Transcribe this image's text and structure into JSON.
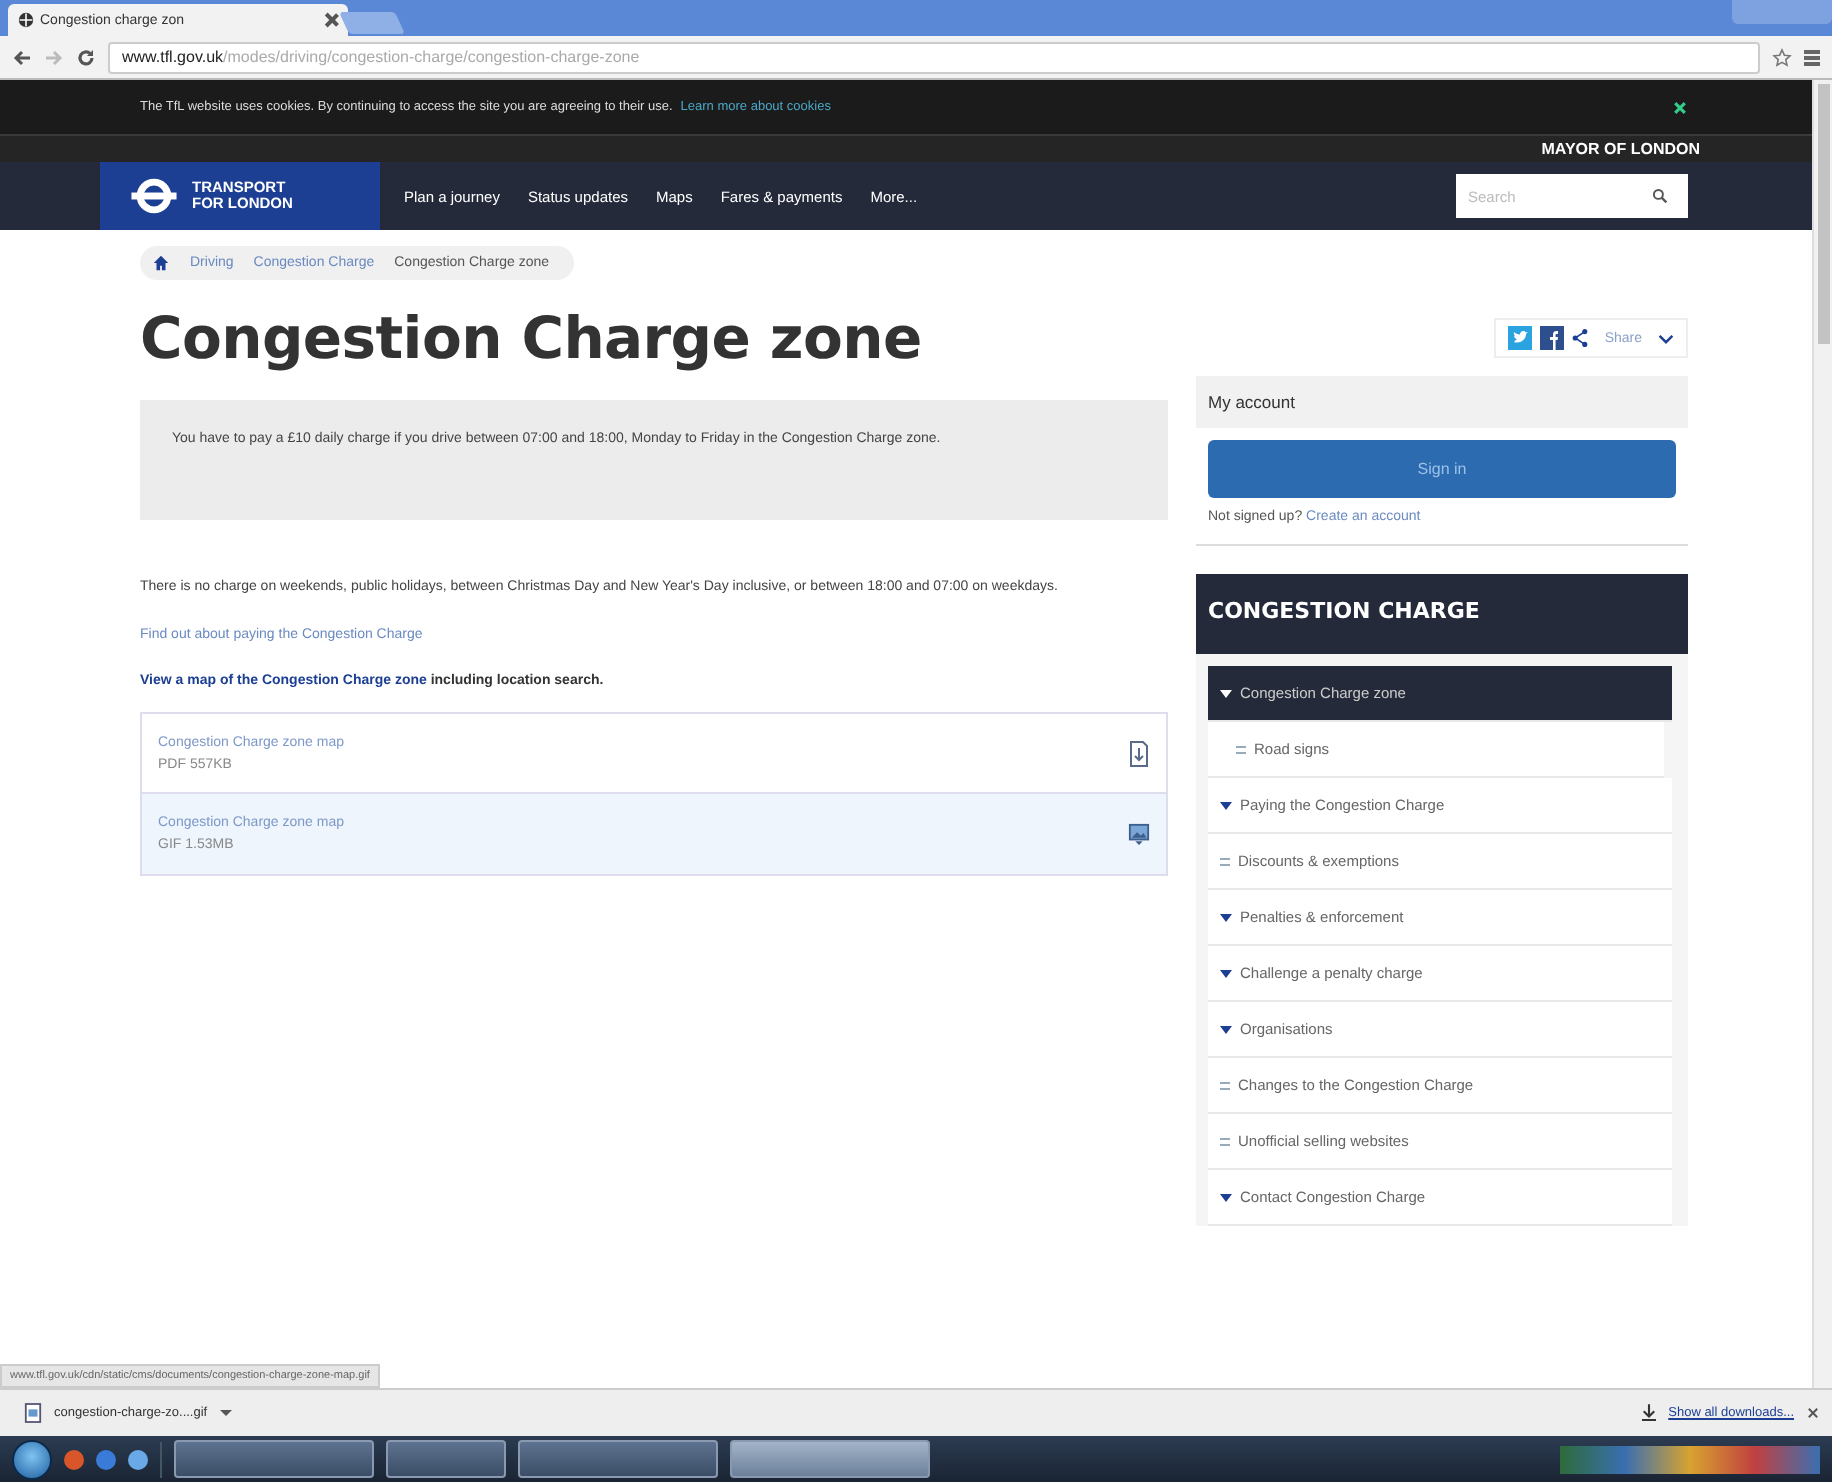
{
  "browser": {
    "tab": {
      "title": "Congestion charge zon"
    },
    "url_host": "www.tfl.gov.uk",
    "url_path": "/modes/driving/congestion-charge/congestion-charge-zone"
  },
  "cookie_bar": {
    "text": "The TfL website uses cookies. By continuing to access the site you are agreeing to their use.",
    "link": "Learn more about cookies"
  },
  "header": {
    "mayor": "MAYOR OF LONDON",
    "logo_lines": [
      "TRANSPORT",
      "FOR LONDON"
    ],
    "nav": [
      {
        "label": "Plan a journey"
      },
      {
        "label": "Status updates"
      },
      {
        "label": "Maps"
      },
      {
        "label": "Fares & payments"
      },
      {
        "label": "More..."
      }
    ],
    "search": {
      "placeholder": "Search"
    }
  },
  "breadcrumb": [
    {
      "label": "Driving"
    },
    {
      "label": "Congestion Charge"
    },
    {
      "label": "Congestion Charge zone"
    }
  ],
  "title": "Congestion Charge zone",
  "share": {
    "label": "Share"
  },
  "notice": "You have to pay a £10 daily charge if you drive between 07:00 and 18:00, Monday to Friday in the Congestion Charge zone.",
  "paragraph": "There is no charge on weekends, public holidays, between Christmas Day and New Year's Day inclusive, or between 18:00 and 07:00 on weekdays.",
  "pay_link": "Find out about paying the Congestion Charge",
  "map_link": {
    "link": "View a map of the Congestion Charge zone",
    "rest": " including location search."
  },
  "files": [
    {
      "title": "Congestion Charge zone map",
      "meta": "PDF 557KB",
      "kind": "pdf",
      "selected": false
    },
    {
      "title": "Congestion Charge zone map",
      "meta": "GIF 1.53MB",
      "kind": "image",
      "selected": true
    }
  ],
  "account": {
    "heading": "My account",
    "button": "Sign in",
    "prompt": "Not signed up?",
    "link": "Create an account"
  },
  "section": {
    "heading": "CONGESTION CHARGE",
    "items": [
      {
        "label": "Congestion Charge zone",
        "kind": "arrow",
        "selected": true,
        "children": [
          {
            "label": "Road signs",
            "kind": "dash",
            "selected": false
          }
        ]
      },
      {
        "label": "Paying the Congestion Charge",
        "kind": "arrow",
        "selected": false
      },
      {
        "label": "Discounts & exemptions",
        "kind": "dash",
        "selected": false
      },
      {
        "label": "Penalties & enforcement",
        "kind": "arrow",
        "selected": false
      },
      {
        "label": "Challenge a penalty charge",
        "kind": "arrow",
        "selected": false
      },
      {
        "label": "Organisations",
        "kind": "arrow",
        "selected": false
      },
      {
        "label": "Changes to the Congestion Charge",
        "kind": "dash",
        "selected": false
      },
      {
        "label": "Unofficial selling websites",
        "kind": "dash",
        "selected": false
      },
      {
        "label": "Contact Congestion Charge",
        "kind": "arrow",
        "selected": false
      }
    ]
  },
  "status_url": "www.tfl.gov.uk/cdn/static/cms/documents/congestion-charge-zone-map.gif",
  "downloads": {
    "file": "congestion-charge-zo....gif",
    "show_all": "Show all downloads..."
  }
}
